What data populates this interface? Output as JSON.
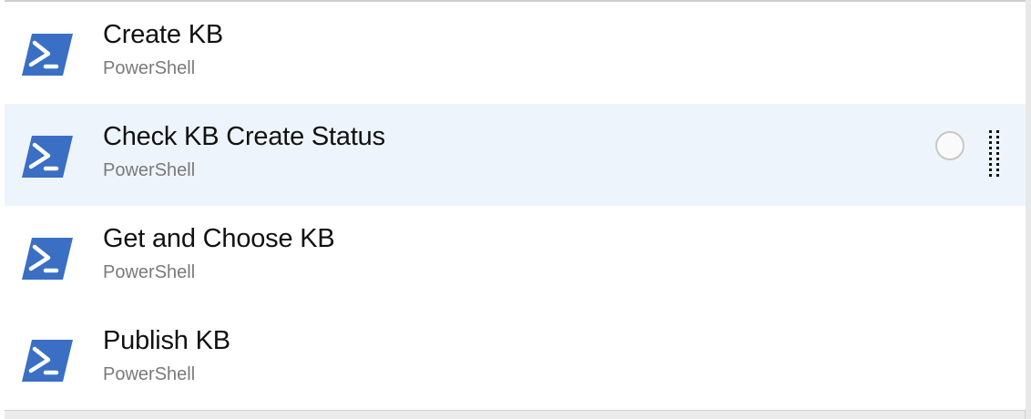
{
  "list": {
    "items": [
      {
        "title": "Create KB",
        "subtitle": "PowerShell",
        "icon": "powershell-icon",
        "selected": false
      },
      {
        "title": "Check KB Create Status",
        "subtitle": "PowerShell",
        "icon": "powershell-icon",
        "selected": true
      },
      {
        "title": "Get and Choose KB",
        "subtitle": "PowerShell",
        "icon": "powershell-icon",
        "selected": false
      },
      {
        "title": "Publish KB",
        "subtitle": "PowerShell",
        "icon": "powershell-icon",
        "selected": false
      }
    ]
  },
  "colors": {
    "icon_background": "#3a6fc4",
    "selected_row": "#eef4fb",
    "title_text": "#111111",
    "subtitle_text": "#7a7a7a"
  }
}
